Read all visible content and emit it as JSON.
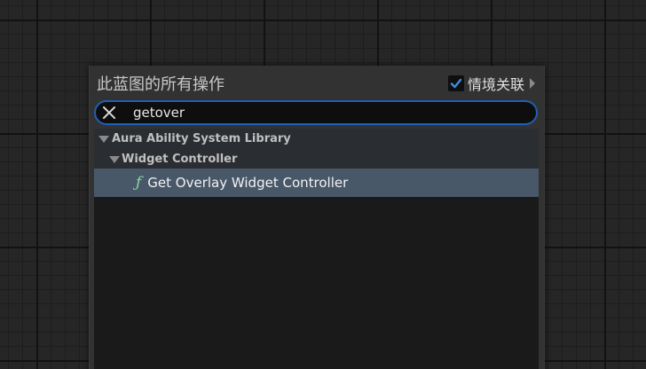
{
  "menu": {
    "title": "此蓝图的所有操作",
    "context_toggle": {
      "label": "情境关联",
      "checked": true
    }
  },
  "search": {
    "value": "getover"
  },
  "results": {
    "category": "Aura Ability System Library",
    "subcategory": "Widget Controller",
    "items": [
      {
        "label": "Get Overlay Widget Controller",
        "icon": "function-icon",
        "selected": true
      }
    ]
  },
  "colors": {
    "accent": "#1f5fb5",
    "selected_row": "#485869",
    "function_icon": "#8fd69a",
    "checkbox_check": "#3a8ee6"
  }
}
